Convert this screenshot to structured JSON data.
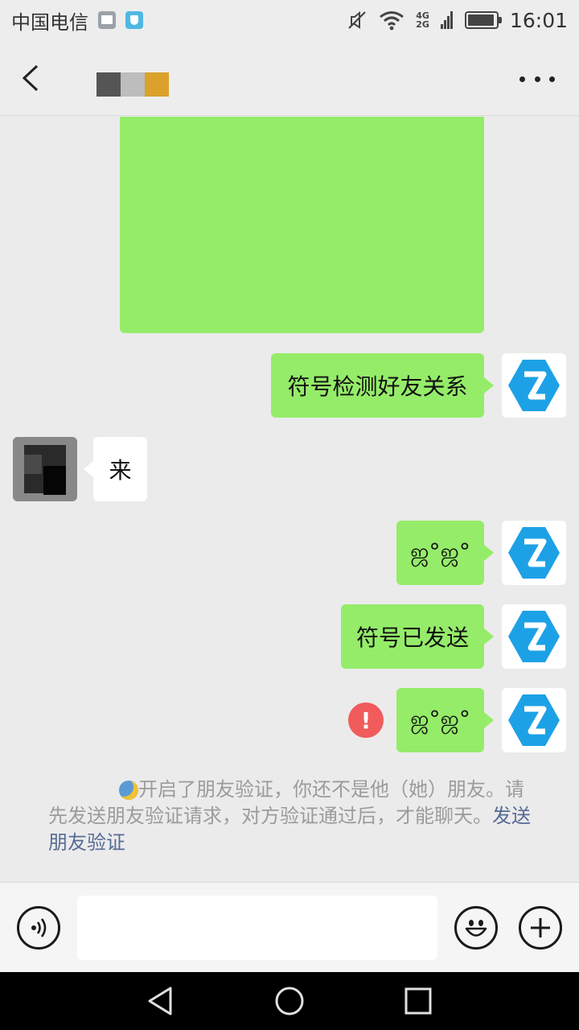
{
  "status_bar": {
    "carrier": "中国电信",
    "network_top": "4G",
    "network_bottom": "2G",
    "time": "16:01",
    "icons": [
      "gallery-icon",
      "shield-icon",
      "mute-icon",
      "wifi-icon",
      "signal-icon",
      "battery-icon"
    ]
  },
  "header": {
    "back_icon": "chevron-left-icon",
    "more_icon": "more-dots-icon",
    "name_mask_colors": [
      "#555555",
      "#bdbdbd",
      "#dba12b"
    ]
  },
  "messages": [
    {
      "id": "m1",
      "side": "self",
      "type": "image",
      "text": ""
    },
    {
      "id": "m2",
      "side": "self",
      "type": "text",
      "text": "符号检测好友关系"
    },
    {
      "id": "m3",
      "side": "other",
      "type": "text",
      "text": "来"
    },
    {
      "id": "m4",
      "side": "self",
      "type": "text",
      "text": "ஜ°ஜ°"
    },
    {
      "id": "m5",
      "side": "self",
      "type": "text",
      "text": "符号已发送"
    },
    {
      "id": "m6",
      "side": "self",
      "type": "text",
      "text": "ஜ°ஜ°",
      "failed": true,
      "status_mark": "!"
    }
  ],
  "system_notice": {
    "text": "开启了朋友验证，你还不是他（她）朋友。请先发送朋友验证请求，对方验证通过后，才能聊天。",
    "link_text": "发送朋友验证"
  },
  "input_bar": {
    "voice_icon": "voice-icon",
    "emoji_icon": "emoji-icon",
    "plus_icon": "plus-icon",
    "input_value": ""
  },
  "nav_bar": {
    "icons": [
      "back-triangle-icon",
      "home-circle-icon",
      "recents-square-icon"
    ]
  },
  "colors": {
    "self_bubble": "#95ec69",
    "other_bubble": "#ffffff",
    "avatar_logo": "#1da1e6",
    "error": "#f15b5b",
    "link": "#576b95"
  }
}
